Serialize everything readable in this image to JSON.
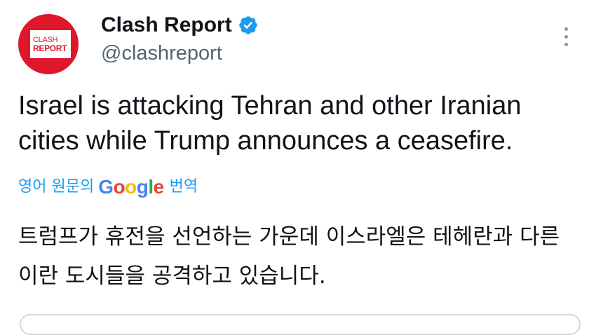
{
  "author": {
    "display_name": "Clash Report",
    "handle": "@clashreport",
    "verified": true,
    "avatar": {
      "line1": "CLASH",
      "line2": "REPORT",
      "color": "#e0162b"
    }
  },
  "menu": {
    "icon": "more-vertical-icon"
  },
  "tweet": {
    "text": "Israel is attacking Tehran and other Iranian cities while Trump announces a ceasefire."
  },
  "translation": {
    "prefix": "영어 원문의",
    "provider": [
      "G",
      "o",
      "o",
      "g",
      "l",
      "e"
    ],
    "suffix": "번역",
    "text": "트럼프가 휴전을 선언하는 가운데 이스라엘은 테헤란과 다른 이란 도시들을 공격하고 있습니다."
  },
  "colors": {
    "link": "#1d9bf0",
    "text": "#0f1419",
    "secondary": "#536471",
    "verified": "#1d9bf0"
  }
}
